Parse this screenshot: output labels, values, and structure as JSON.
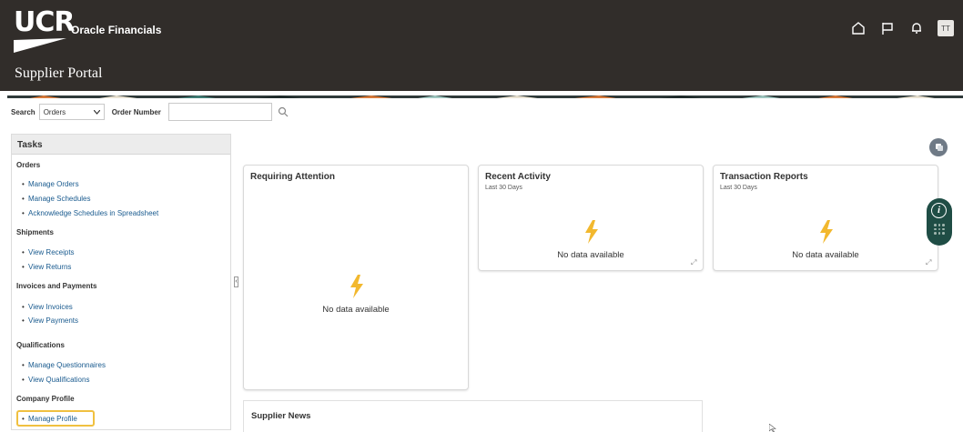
{
  "header": {
    "logo_text": "UCR",
    "app_name": "Oracle Financials",
    "portal_title": "Supplier Portal",
    "avatar_initials": "TT",
    "icons": [
      "home-icon",
      "flag-icon",
      "bell-icon"
    ]
  },
  "search": {
    "label": "Search",
    "selected": "Orders",
    "order_number_label": "Order Number",
    "order_number_value": ""
  },
  "tasks": {
    "title": "Tasks",
    "sections": [
      {
        "title": "Orders",
        "items": [
          "Manage Orders",
          "Manage Schedules",
          "Acknowledge Schedules in Spreadsheet"
        ]
      },
      {
        "title": "Shipments",
        "items": [
          "View Receipts",
          "View Returns"
        ]
      },
      {
        "title": "Invoices and Payments",
        "items": [
          "View Invoices",
          "View Payments"
        ]
      },
      {
        "title": "Qualifications",
        "items": [
          "Manage Questionnaires",
          "View Qualifications"
        ]
      },
      {
        "title": "Company Profile",
        "items": [
          "Manage Profile"
        ]
      }
    ]
  },
  "cards": {
    "requiring_attention": {
      "title": "Requiring Attention",
      "empty": "No data available"
    },
    "recent_activity": {
      "title": "Recent Activity",
      "subtitle": "Last 30 Days",
      "empty": "No data available"
    },
    "transaction_reports": {
      "title": "Transaction Reports",
      "subtitle": "Last 30 Days",
      "empty": "No data available"
    },
    "supplier_news": {
      "title": "Supplier News"
    }
  },
  "colors": {
    "header_bg": "#312d2a",
    "link": "#1a5b8f",
    "highlight": "#f0c040",
    "bolt": "#f2b82e",
    "info_pill": "#1f4d45"
  }
}
